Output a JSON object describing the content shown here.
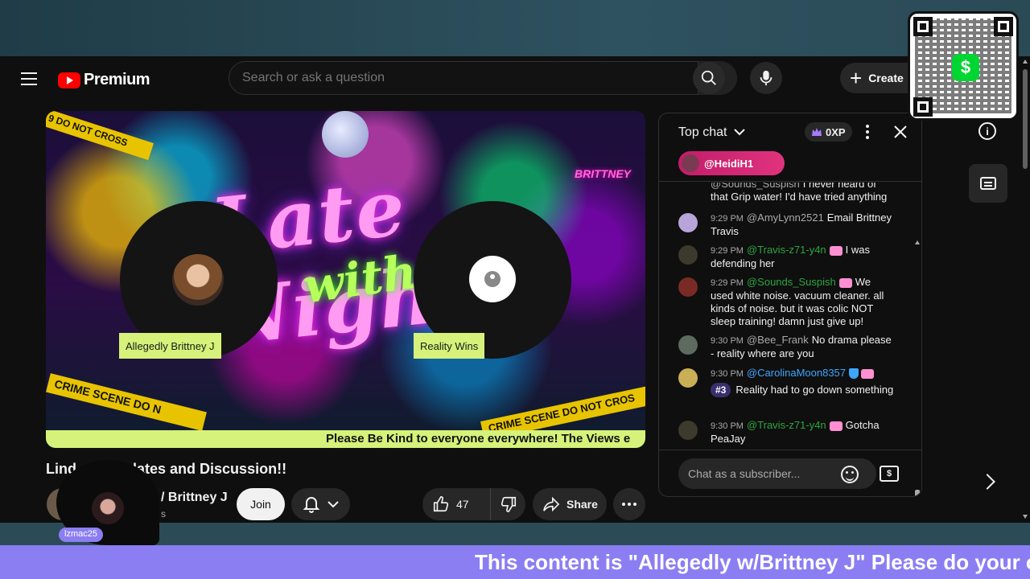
{
  "header": {
    "logo_text": "Premium",
    "search_placeholder": "Search or ask a question",
    "create_label": "Create"
  },
  "player": {
    "artwork_title_line1": "Late Night",
    "artwork_title_line2": "with",
    "artwork_brand": "BRITTNEY",
    "crime_tape_top": "9 DO NOT CROSS",
    "crime_tape_bottom_left": "CRIME SCENE DO N",
    "crime_tape_bottom_right": "CRIME SCENE DO NOT CROS",
    "guest_left_name": "Allegedly Brittney J",
    "guest_right_name": "Reality Wins",
    "ticker_text": "Please Be Kind to everyone everywhere! The Views e"
  },
  "video": {
    "title": "Lind     ccy Updates and Discussion!!",
    "channel_name": "/ Brittney J",
    "channel_subs": "s",
    "join_label": "Join",
    "like_count": "47",
    "share_label": "Share"
  },
  "webcam": {
    "tag": "lzmac25"
  },
  "chat": {
    "title": "Top chat",
    "xp": "0XP",
    "pinned_user": "@HeidiH1",
    "input_placeholder": "Chat as a subscriber...",
    "super_label": "$",
    "messages": [
      {
        "time": "",
        "author": "@Sounds_Suspish",
        "text": "I never heard of that Grip water! I'd have tried anything",
        "color": "#aaaaaa"
      },
      {
        "time": "9:29 PM",
        "author": "@AmyLynn2521",
        "text": "Email Brittney Travis",
        "color": "#aaaaaa"
      },
      {
        "time": "9:29 PM",
        "author": "@Travis-z71-y4n",
        "text": "I was defending her",
        "color": "#2ba640"
      },
      {
        "time": "9:29 PM",
        "author": "@Sounds_Suspish",
        "text": "We used white noise. vacuum cleaner. all kinds of noise. but it was colic NOT sleep training! damn just give up!",
        "color": "#2ba640"
      },
      {
        "time": "9:30 PM",
        "author": "@Bee_Frank",
        "text": "No drama please - reality where are you",
        "color": "#aaaaaa"
      },
      {
        "time": "9:30 PM",
        "author": "@CarolinaMoon8357",
        "rank": "#3",
        "text": "Reality had to go down something",
        "color": "#3ea6ff"
      },
      {
        "time": "9:30 PM",
        "author": "@Travis-z71-y4n",
        "text": "Gotcha PeaJay",
        "color": "#2ba640"
      }
    ]
  },
  "overlay": {
    "bottom_ticker": "This content is \"Allegedly w/Brittney J\" Please do your ow",
    "qr_logo": "$"
  },
  "colors": {
    "brand_red": "#ff0000",
    "accent_green": "#d6f27a",
    "ticker_purple": "#8b7ef2",
    "cashapp_green": "#00d632"
  }
}
